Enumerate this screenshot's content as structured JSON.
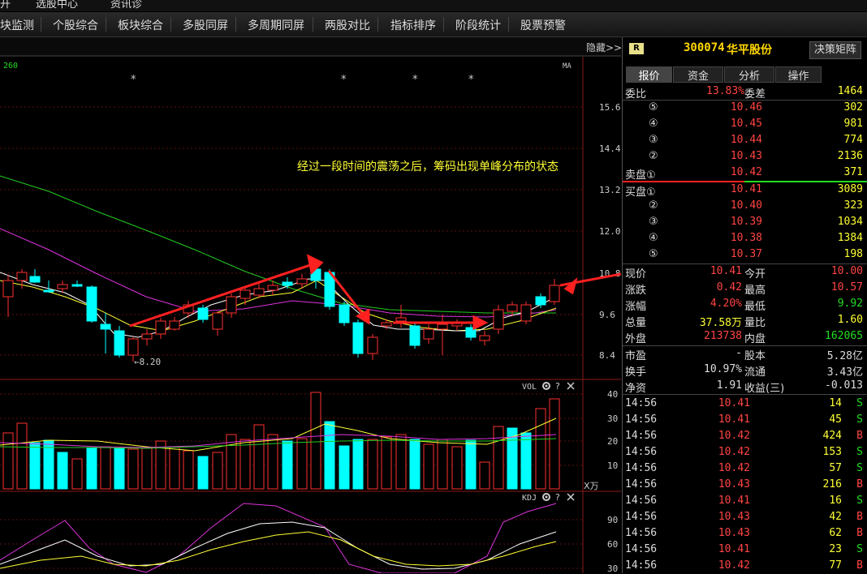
{
  "topbar": [
    "开",
    "选股中心",
    "资讯诊"
  ],
  "tabs": [
    "块监测",
    "个股综合",
    "板块综合",
    "多股同屏",
    "多周期同屏",
    "两股对比",
    "指标排序",
    "阶段统计",
    "股票预警"
  ],
  "chart": {
    "hide_label": "隐藏>>",
    "ma_label": "MA",
    "period_label": "260",
    "annotation": "经过一段时间的震荡之后，筹码出现单峰分布的状态",
    "low_label": "←8.20",
    "price_axis": [
      "15.6",
      "14.4",
      "13.2",
      "12.0",
      "10.8",
      "9.6",
      "8.4"
    ],
    "vol_label": "VOL",
    "vol_axis": [
      "40",
      "30",
      "20",
      "10"
    ],
    "vol_unit": "X万",
    "kdj_label": "KDJ",
    "kdj_axis": [
      "90",
      "60",
      "30"
    ],
    "star": "*",
    "gear_icon": "gear-icon",
    "help_icon": "help-icon",
    "close_icon": "close-icon"
  },
  "panel": {
    "badge": "R",
    "code": "300074",
    "name": "华平股份",
    "matrix_button": "决策矩阵",
    "tabs": [
      "报价",
      "资金",
      "分析",
      "操作"
    ],
    "weibi": {
      "label": "委比",
      "value": "13.83%",
      "label2": "委差",
      "value2": "1464"
    },
    "sell": [
      {
        "label": "⑤",
        "price": "10.46",
        "vol": "302"
      },
      {
        "label": "④",
        "price": "10.45",
        "vol": "981"
      },
      {
        "label": "③",
        "price": "10.44",
        "vol": "774"
      },
      {
        "label": "②",
        "price": "10.43",
        "vol": "2136"
      },
      {
        "label": "卖盘①",
        "price": "10.42",
        "vol": "371"
      }
    ],
    "buy": [
      {
        "label": "买盘①",
        "price": "10.41",
        "vol": "3089"
      },
      {
        "label": "②",
        "price": "10.40",
        "vol": "323"
      },
      {
        "label": "③",
        "price": "10.39",
        "vol": "1034"
      },
      {
        "label": "④",
        "price": "10.38",
        "vol": "1384"
      },
      {
        "label": "⑤",
        "price": "10.37",
        "vol": "198"
      }
    ],
    "quote": [
      {
        "l1": "现价",
        "v1": "10.41",
        "l2": "今开",
        "v2": "10.00",
        "c1": "red",
        "c2": "red"
      },
      {
        "l1": "涨跌",
        "v1": "0.42",
        "l2": "最高",
        "v2": "10.57",
        "c1": "red",
        "c2": "red"
      },
      {
        "l1": "涨幅",
        "v1": "4.20%",
        "l2": "最低",
        "v2": "9.92",
        "c1": "red",
        "c2": "green"
      },
      {
        "l1": "总量",
        "v1": "37.58万",
        "l2": "量比",
        "v2": "1.60",
        "c1": "yellow",
        "c2": "yellow"
      },
      {
        "l1": "外盘",
        "v1": "213738",
        "l2": "内盘",
        "v2": "162065",
        "c1": "red",
        "c2": "green"
      }
    ],
    "stats": [
      {
        "l1": "市盈",
        "v1": "-",
        "l2": "股本",
        "v2": "5.28亿"
      },
      {
        "l1": "换手",
        "v1": "10.97%",
        "l2": "流通",
        "v2": "3.43亿"
      },
      {
        "l1": "净资",
        "v1": "1.91",
        "l2": "收益(三)",
        "v2": "-0.013"
      }
    ],
    "ticks": [
      {
        "t": "14:56",
        "p": "10.41",
        "v": "14",
        "s": "S"
      },
      {
        "t": "14:56",
        "p": "10.41",
        "v": "45",
        "s": "S"
      },
      {
        "t": "14:56",
        "p": "10.42",
        "v": "424",
        "s": "B"
      },
      {
        "t": "14:56",
        "p": "10.42",
        "v": "153",
        "s": "S"
      },
      {
        "t": "14:56",
        "p": "10.42",
        "v": "57",
        "s": "S"
      },
      {
        "t": "14:56",
        "p": "10.43",
        "v": "216",
        "s": "B"
      },
      {
        "t": "14:56",
        "p": "10.41",
        "v": "16",
        "s": "S"
      },
      {
        "t": "14:56",
        "p": "10.43",
        "v": "42",
        "s": "B"
      },
      {
        "t": "14:56",
        "p": "10.43",
        "v": "62",
        "s": "B"
      },
      {
        "t": "14:56",
        "p": "10.41",
        "v": "23",
        "s": "S"
      },
      {
        "t": "14:56",
        "p": "10.42",
        "v": "77",
        "s": "B"
      }
    ]
  }
}
